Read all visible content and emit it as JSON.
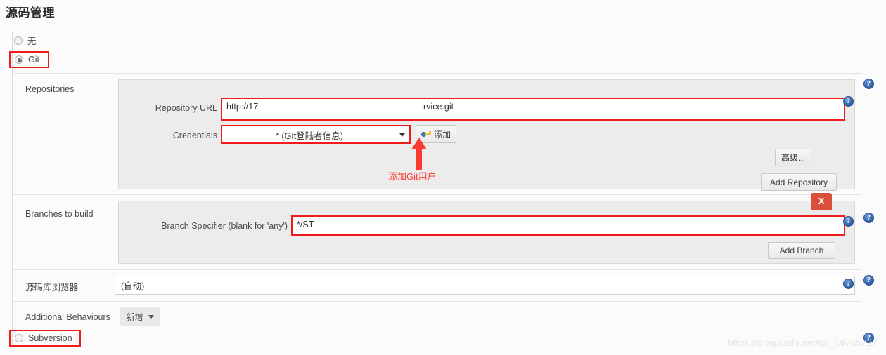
{
  "page": {
    "title": "源码管理",
    "watermark": "https://blog.csdn.net/qq_19765727"
  },
  "scm_options": [
    {
      "label": "无",
      "selected": false,
      "highlighted": false
    },
    {
      "label": "Git",
      "selected": true,
      "highlighted": true
    },
    {
      "label": "Subversion",
      "selected": false,
      "highlighted": true
    }
  ],
  "sections": {
    "repositories": {
      "label": "Repositories",
      "repository_url": {
        "label": "Repository URL",
        "value_start": "http://17",
        "value_end": "rvice.git"
      },
      "credentials": {
        "label": "Credentials",
        "value": "* (GIt登陆者信息)"
      },
      "add_credentials_button": "添加",
      "advanced_button": "高级...",
      "add_repository_button": "Add Repository"
    },
    "branches": {
      "label": "Branches to build",
      "branch_specifier": {
        "label": "Branch Specifier (blank for 'any')",
        "value": "*/ST"
      },
      "delete_button": "X",
      "add_branch_button": "Add Branch"
    },
    "browser": {
      "label": "源码库浏览器",
      "value": "(自动)"
    },
    "additional_behaviours": {
      "label": "Additional Behaviours",
      "add_button": "新增"
    }
  },
  "annotation": {
    "text": "添加Git用户",
    "color": "#fb3b30"
  },
  "help_icon_label": "?",
  "colors": {
    "highlight_red": "#ef1c1c",
    "delete_red": "#da4f3c",
    "panel_grey": "#ececec",
    "page_bg": "#fbfbfb"
  }
}
